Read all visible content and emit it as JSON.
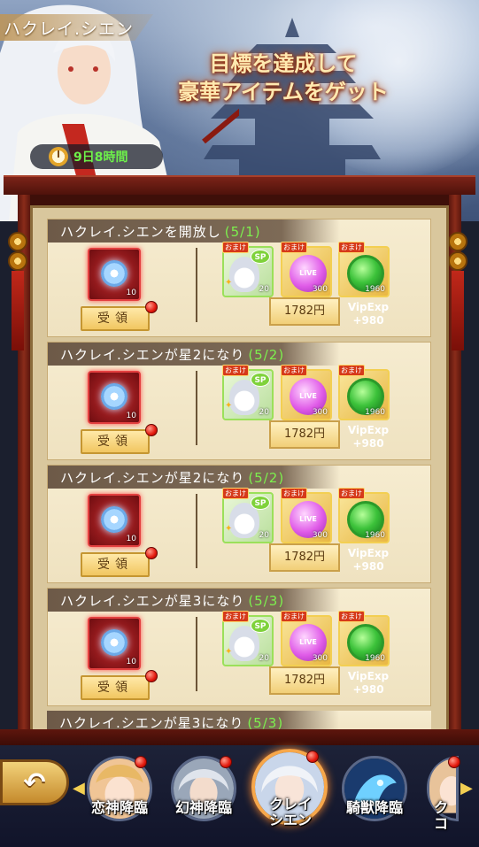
{
  "banner": {
    "character_name": "ハクレイ.シエン",
    "headline_line1": "目標を達成して",
    "headline_line2": "豪華アイテムをゲット",
    "timer": "9日8時間",
    "icons": [
      "clock-icon"
    ]
  },
  "tasks": [
    {
      "title": "ハクレイ.シエンを開放し",
      "progress": "(5/1)",
      "item_count": "10",
      "claim_label": "受領",
      "bonus_tag": "おまけ",
      "reward1_count": "20",
      "reward2_count": "300",
      "reward3_count": "1960",
      "reward2_badge": "LIVE",
      "sp_label": "SP",
      "price": "1782円",
      "vip_line1": "VipExp",
      "vip_line2": "+980"
    },
    {
      "title": "ハクレイ.シエンが星2になり",
      "progress": "(5/2)",
      "item_count": "10",
      "claim_label": "受領",
      "bonus_tag": "おまけ",
      "reward1_count": "20",
      "reward2_count": "300",
      "reward3_count": "1960",
      "reward2_badge": "LIVE",
      "sp_label": "SP",
      "price": "1782円",
      "vip_line1": "VipExp",
      "vip_line2": "+980"
    },
    {
      "title": "ハクレイ.シエンが星2になり",
      "progress": "(5/2)",
      "item_count": "10",
      "claim_label": "受領",
      "bonus_tag": "おまけ",
      "reward1_count": "20",
      "reward2_count": "300",
      "reward3_count": "1960",
      "reward2_badge": "LIVE",
      "sp_label": "SP",
      "price": "1782円",
      "vip_line1": "VipExp",
      "vip_line2": "+980"
    },
    {
      "title": "ハクレイ.シエンが星3になり",
      "progress": "(5/3)",
      "item_count": "10",
      "claim_label": "受領",
      "bonus_tag": "おまけ",
      "reward1_count": "20",
      "reward2_count": "300",
      "reward3_count": "1960",
      "reward2_badge": "LIVE",
      "sp_label": "SP",
      "price": "1782円",
      "vip_line1": "VipExp",
      "vip_line2": "+980"
    },
    {
      "title": "ハクレイ.シエンが星3になり",
      "progress": "(5/3)"
    }
  ],
  "nav": {
    "back_icon": "back-arrow-icon",
    "items": [
      {
        "label": "恋神降臨",
        "active": false
      },
      {
        "label": "幻神降臨",
        "active": false
      },
      {
        "label": "クレイ\nシエン",
        "active": true
      },
      {
        "label": "騎獣降臨",
        "active": false
      },
      {
        "label": "ク\nコ",
        "active": false
      }
    ]
  },
  "colors": {
    "progress_green": "#7df04e",
    "timer_green": "#6df04a",
    "frame_red": "#7b2318",
    "active_avatar_ring": "#f7a74a"
  }
}
